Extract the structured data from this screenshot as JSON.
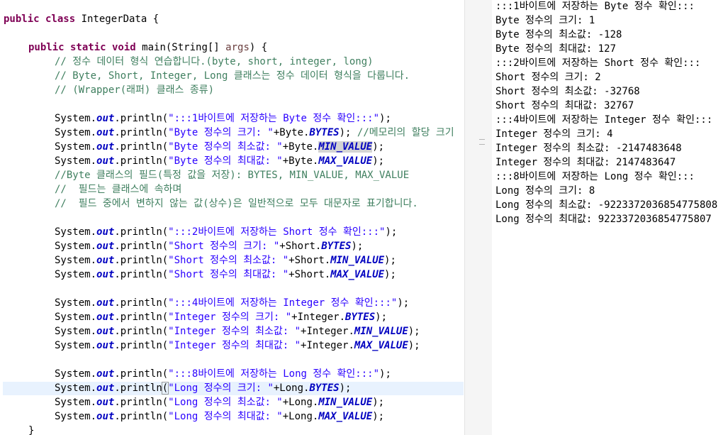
{
  "editor": {
    "class_decl": {
      "kw": "public class ",
      "rest": "IntegerData {"
    },
    "main_decl": {
      "kw": "public static void ",
      "pre": "main(String[] ",
      "param": "args",
      "post": ") {"
    },
    "comments": [
      "// 정수 데이터 형식 연습합니다.(byte, short, integer, long)",
      "// Byte, Short, Integer, Long 클래스는 정수 데이터 형식을 다룹니다.",
      "// (Wrapper(래퍼) 클래스 종류)"
    ],
    "field_comments": [
      "//Byte 클래스의 필드(특정 값을 저장): BYTES, MIN_VALUE, MAX_VALUE",
      "//  필드는 클래스에 속하며",
      "//  필드 중에서 변하지 않는 값(상수)은 일반적으로 모두 대문자로 표기합니다."
    ],
    "tokens": {
      "system": "System.",
      "out": "out",
      "println": ".println(",
      "close": ");",
      "plus": "+"
    },
    "groups": [
      {
        "header": "\":::1바이트에 저장하는 Byte 정수 확인:::\"",
        "rows": [
          {
            "str": "\"Byte 정수의 크기: \"",
            "cls": "Byte.",
            "field": "BYTES",
            "trail": "); ",
            "comment": "//메모리의 할당 크기"
          },
          {
            "str": "\"Byte 정수의 최소값: \"",
            "cls": "Byte.",
            "field": "MIN_VALUE",
            "trail": ");"
          },
          {
            "str": "\"Byte 정수의 최대값: \"",
            "cls": "Byte.",
            "field": "MAX_VALUE",
            "trail": ");"
          }
        ]
      },
      {
        "header": "\":::2바이트에 저장하는 Short 정수 확인:::\"",
        "rows": [
          {
            "str": "\"Short 정수의 크기: \"",
            "cls": "Short.",
            "field": "BYTES",
            "trail": ");"
          },
          {
            "str": "\"Short 정수의 최소값: \"",
            "cls": "Short.",
            "field": "MIN_VALUE",
            "trail": ");"
          },
          {
            "str": "\"Short 정수의 최대값: \"",
            "cls": "Short.",
            "field": "MAX_VALUE",
            "trail": ");"
          }
        ]
      },
      {
        "header": "\":::4바이트에 저장하는 Integer 정수 확인:::\"",
        "rows": [
          {
            "str": "\"Integer 정수의 크기: \"",
            "cls": "Integer.",
            "field": "BYTES",
            "trail": ");"
          },
          {
            "str": "\"Integer 정수의 최소값: \"",
            "cls": "Integer.",
            "field": "MIN_VALUE",
            "trail": ");"
          },
          {
            "str": "\"Integer 정수의 최대값: \"",
            "cls": "Integer.",
            "field": "MAX_VALUE",
            "trail": ");"
          }
        ]
      },
      {
        "header": "\":::8바이트에 저장하는 Long 정수 확인:::\"",
        "rows": [
          {
            "str": "\"Long 정수의 크기: \"",
            "cls": "Long.",
            "field": "BYTES",
            "trail": ");"
          },
          {
            "str": "\"Long 정수의 최소값: \"",
            "cls": "Long.",
            "field": "MIN_VALUE",
            "trail": ");"
          },
          {
            "str": "\"Long 정수의 최대값: \"",
            "cls": "Long.",
            "field": "MAX_VALUE",
            "trail": ");"
          }
        ]
      }
    ],
    "closing_brace": "}"
  },
  "console": {
    "lines": [
      ":::1바이트에 저장하는 Byte 정수 확인:::",
      "Byte 정수의 크기: 1",
      "Byte 정수의 최소값: -128",
      "Byte 정수의 최대값: 127",
      ":::2바이트에 저장하는 Short 정수 확인:::",
      "Short 정수의 크기: 2",
      "Short 정수의 최소값: -32768",
      "Short 정수의 최대값: 32767",
      ":::4바이트에 저장하는 Integer 정수 확인:::",
      "Integer 정수의 크기: 4",
      "Integer 정수의 최소값: -2147483648",
      "Integer 정수의 최대값: 2147483647",
      ":::8바이트에 저장하는 Long 정수 확인:::",
      "Long 정수의 크기: 8",
      "Long 정수의 최소값: -9223372036854775808",
      "Long 정수의 최대값: 9223372036854775807"
    ]
  },
  "colors": {
    "keyword": "#7f0055",
    "string": "#2a00ff",
    "comment": "#3f7f5f",
    "static_field": "#0000c0",
    "current_line": "#e8f2fe",
    "selection": "#d4d4d4"
  }
}
